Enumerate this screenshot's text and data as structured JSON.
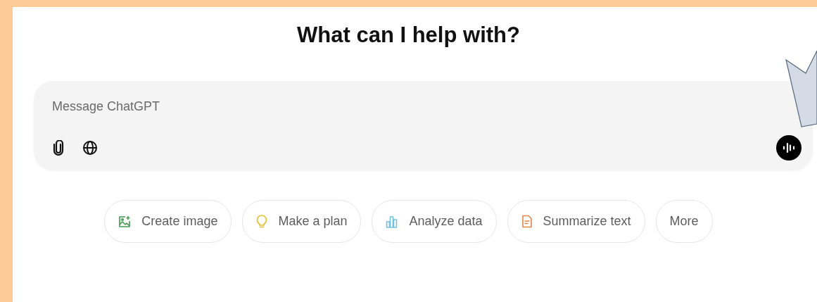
{
  "heading": "What can I help with?",
  "composer": {
    "placeholder": "Message ChatGPT"
  },
  "suggestions": [
    {
      "label": "Create image"
    },
    {
      "label": "Make a plan"
    },
    {
      "label": "Analyze data"
    },
    {
      "label": "Summarize text"
    },
    {
      "label": "More"
    }
  ]
}
